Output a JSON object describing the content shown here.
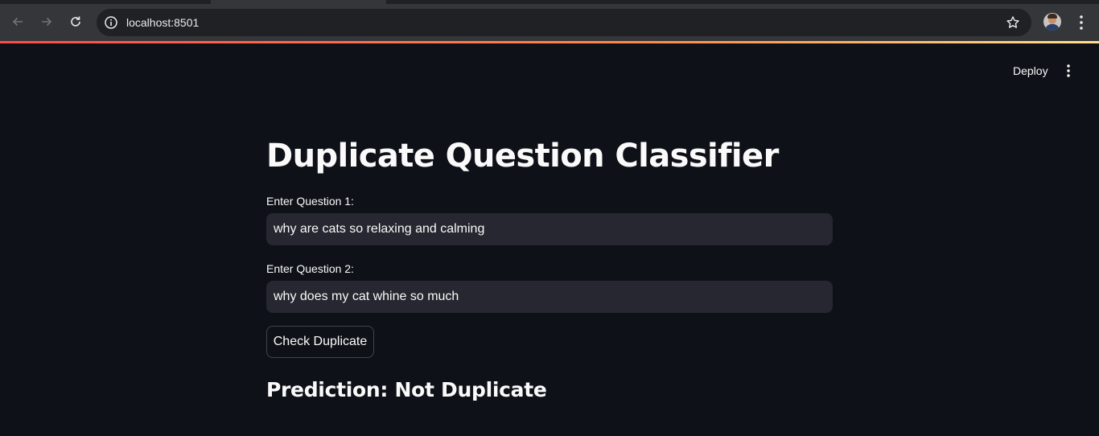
{
  "browser": {
    "url": "localhost:8501",
    "icons": {
      "back": "arrow-left-icon",
      "forward": "arrow-right-icon",
      "reload": "reload-icon",
      "site_info": "info-icon",
      "bookmark": "star-icon",
      "profile": "avatar",
      "menu": "kebab-menu-icon"
    }
  },
  "header": {
    "deploy_label": "Deploy",
    "menu_icon": "kebab-menu-icon"
  },
  "main": {
    "title": "Duplicate Question Classifier",
    "question1": {
      "label": "Enter Question 1:",
      "value": "why are cats so relaxing and calming"
    },
    "question2": {
      "label": "Enter Question 2:",
      "value": "why does my cat whine so much"
    },
    "check_button_label": "Check Duplicate",
    "prediction": "Prediction: Not Duplicate"
  },
  "colors": {
    "background": "#0e1117",
    "input_background": "#262730",
    "text": "#fafafa",
    "accent": "#ff4b4b"
  }
}
